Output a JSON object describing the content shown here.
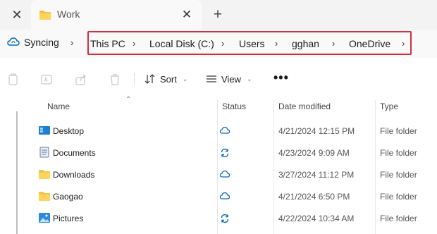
{
  "tabbar": {
    "tab_title": "Work",
    "close_glyph": "✕",
    "new_tab_glyph": "+"
  },
  "address": {
    "sync_label": "Syncing",
    "breadcrumbs": [
      "This PC",
      "Local Disk (C:)",
      "Users",
      "gghan",
      "OneDrive"
    ]
  },
  "toolbar": {
    "sort_label": "Sort",
    "view_label": "View",
    "more_label": "•••"
  },
  "columns": {
    "name": "Name",
    "status": "Status",
    "date": "Date modified",
    "type": "Type"
  },
  "files": [
    {
      "name": "Desktop",
      "icon": "desktop-folder-icon",
      "status": "cloud-icon",
      "date": "4/21/2024 12:15 PM",
      "type": "File folder"
    },
    {
      "name": "Documents",
      "icon": "documents-folder-icon",
      "status": "sync-pending-icon",
      "date": "4/23/2024 9:09 AM",
      "type": "File folder"
    },
    {
      "name": "Downloads",
      "icon": "folder-icon",
      "status": "cloud-icon",
      "date": "3/27/2024 11:12 PM",
      "type": "File folder"
    },
    {
      "name": "Gaogao",
      "icon": "folder-icon",
      "status": "cloud-icon",
      "date": "4/21/2024 6:50 PM",
      "type": "File folder"
    },
    {
      "name": "Pictures",
      "icon": "pictures-folder-icon",
      "status": "sync-pending-icon",
      "date": "4/22/2024 10:34 AM",
      "type": "File folder"
    }
  ],
  "colors": {
    "accent": "#0067c0",
    "highlight_border": "#d32f3f",
    "folder_yellow": "#f5c342"
  }
}
